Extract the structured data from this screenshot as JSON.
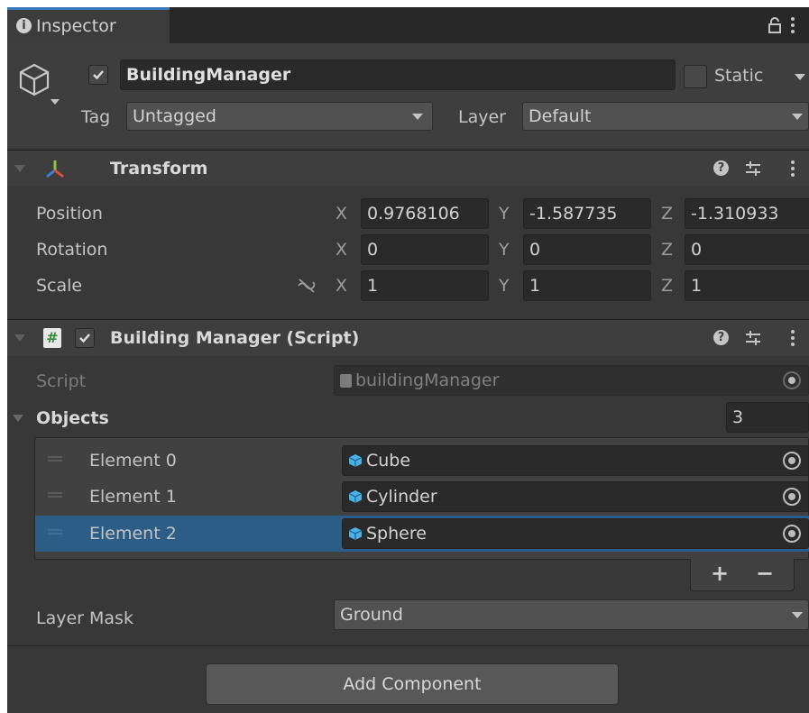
{
  "tab": {
    "title": "Inspector"
  },
  "gameobject": {
    "name": "BuildingManager",
    "active": true,
    "static_label": "Static",
    "tag_label": "Tag",
    "tag_value": "Untagged",
    "layer_label": "Layer",
    "layer_value": "Default"
  },
  "transform": {
    "title": "Transform",
    "position": {
      "label": "Position",
      "x": "0.9768106",
      "y": "-1.587735",
      "z": "-1.310933"
    },
    "rotation": {
      "label": "Rotation",
      "x": "0",
      "y": "0",
      "z": "0"
    },
    "scale": {
      "label": "Scale",
      "x": "1",
      "y": "1",
      "z": "1"
    },
    "axis_x": "X",
    "axis_y": "Y",
    "axis_z": "Z"
  },
  "script_component": {
    "title": "Building Manager (Script)",
    "enabled": true,
    "script_label": "Script",
    "script_value": "buildingManager",
    "objects_label": "Objects",
    "objects_count": "3",
    "elements": [
      {
        "label": "Element 0",
        "value": "Cube"
      },
      {
        "label": "Element 1",
        "value": "Cylinder"
      },
      {
        "label": "Element 2",
        "value": "Sphere"
      }
    ],
    "plus": "+",
    "minus": "−",
    "layer_mask_label": "Layer Mask",
    "layer_mask_value": "Ground"
  },
  "add_component_label": "Add Component",
  "colors": {
    "panel": "#383838",
    "field": "#2a2a2a",
    "selected_row": "#2c5d87",
    "accent": "#3a79bb"
  }
}
